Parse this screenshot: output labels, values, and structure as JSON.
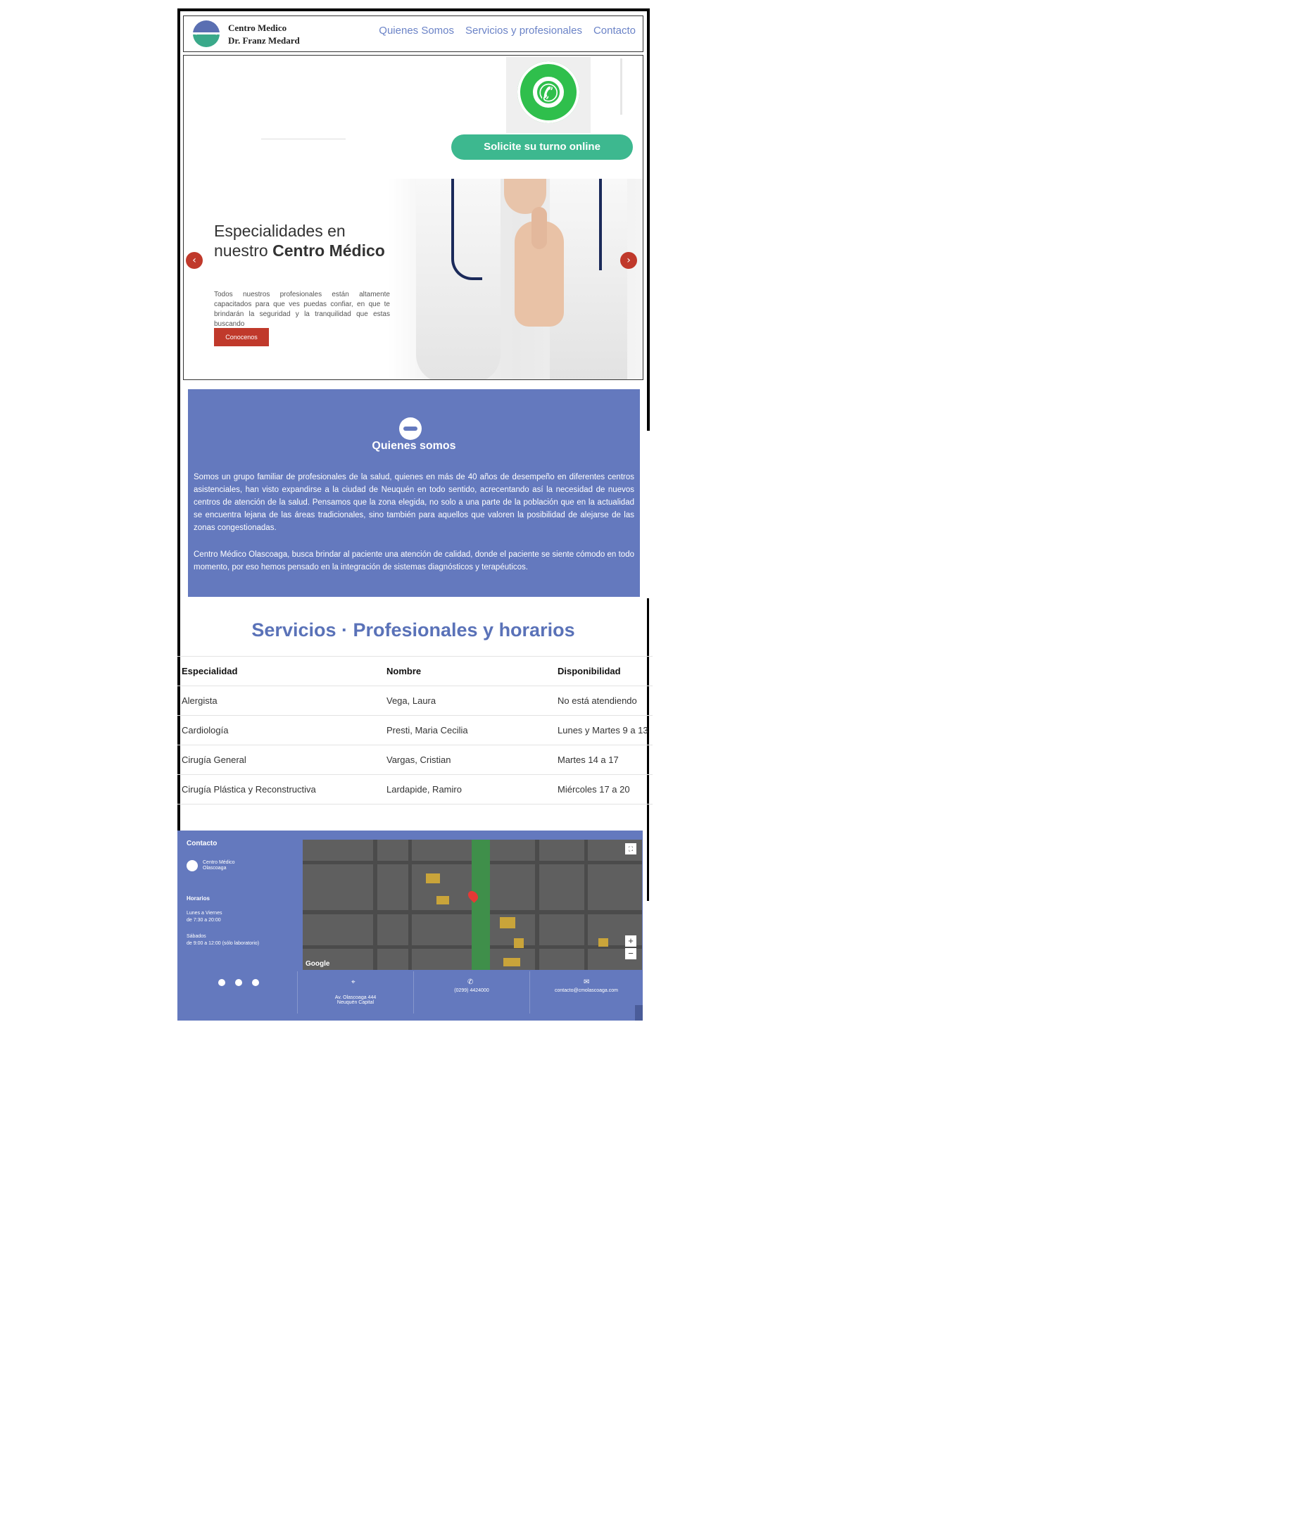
{
  "header": {
    "brand_line1": "Centro Medico",
    "brand_line2": "Dr. Franz Medard",
    "nav": [
      "Quienes Somos",
      "Servicios y profesionales",
      "Contacto"
    ]
  },
  "hero": {
    "cta_label": "Solicite su turno online",
    "slide_title_1": "Especialidades en",
    "slide_title_2": "nuestro",
    "slide_title_bold": "Centro Médico",
    "slide_text": "Todos nuestros profesionales están altamente capacitados para que ves puedas confiar, en que te brindarán la seguridad y la tranquilidad que estas buscando",
    "slide_button": "Conocenos"
  },
  "about": {
    "title": "Quienes somos",
    "p1": "Somos un grupo familiar de profesionales de la salud, quienes en más de 40 años de desempeño en diferentes centros asistenciales, han visto expandirse a la ciudad de Neuquén en todo sentido, acrecentando así la necesidad de nuevos centros de atención de la salud. Pensamos que la zona elegida, no solo a una parte de la población que en la actualidad se encuentra lejana de las áreas tradicionales, sino también para aquellos que valoren la posibilidad de alejarse de las zonas congestionadas.",
    "p2": "Centro Médico Olascoaga, busca brindar al paciente una atención de calidad, donde el paciente se siente cómodo en todo momento, por eso hemos pensado en la integración de sistemas diagnósticos y terapéuticos."
  },
  "services": {
    "title": "Servicios · Profesionales y horarios",
    "headers": [
      "Especialidad",
      "Nombre",
      "Disponibilidad"
    ],
    "rows": [
      [
        "Alergista",
        "Vega, Laura",
        "No está atendiendo"
      ],
      [
        "Cardiología",
        "Presti, Maria Cecilia",
        "Lunes y Martes 9 a 13"
      ],
      [
        "Cirugía General",
        "Vargas, Cristian",
        "Martes 14 a 17"
      ],
      [
        "Cirugía Plástica y Reconstructiva",
        "Lardapide, Ramiro",
        "Miércoles 17 a 20"
      ]
    ]
  },
  "contact": {
    "title": "Contacto",
    "mini_brand_1": "Centro Médico",
    "mini_brand_2": "Olascoaga",
    "hours_title": "Horarios",
    "hours_1a": "Lunes a Viernes",
    "hours_1b": "de 7:30 a 20:00",
    "hours_2a": "Sábados",
    "hours_2b": "de 9:00 a 12:00 (sólo laboratorio)",
    "address_1": "Av. Olascoaga 444",
    "address_2": "Neuquén Capital",
    "phone": "(0299) 4424000",
    "email": "contacto@cmolascoaga.com",
    "map_brand": "Google"
  },
  "colors": {
    "accent_blue": "#6479be",
    "title_blue": "#5a72b8",
    "cta_green": "#3db88f",
    "red": "#c0392b"
  }
}
